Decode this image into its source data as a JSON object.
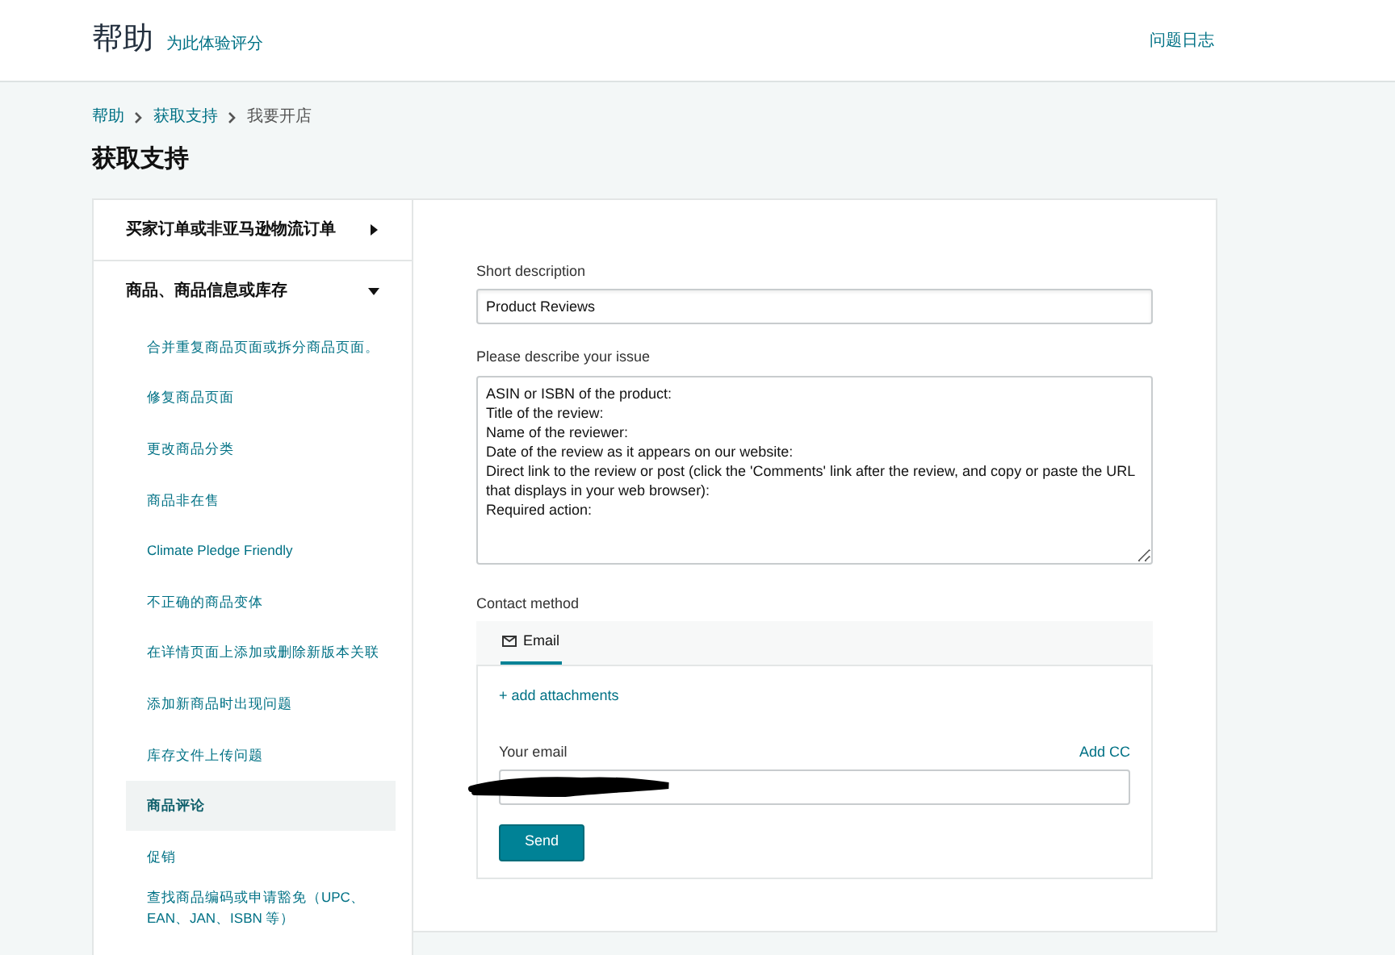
{
  "header": {
    "title": "帮助",
    "rate_link": "为此体验评分",
    "log_link": "问题日志"
  },
  "breadcrumb": [
    {
      "label": "帮助",
      "link": true
    },
    {
      "label": "获取支持",
      "link": true
    },
    {
      "label": "我要开店",
      "link": false
    }
  ],
  "page_title": "获取支持",
  "sidebar": {
    "categories": [
      {
        "label": "买家订单或非亚马逊物流订单",
        "expanded": false
      },
      {
        "label": "商品、商品信息或库存",
        "expanded": true,
        "children": [
          {
            "label": "合并重复商品页面或拆分商品页面。",
            "selected": false
          },
          {
            "label": "修复商品页面",
            "selected": false
          },
          {
            "label": "更改商品分类",
            "selected": false
          },
          {
            "label": "商品非在售",
            "selected": false
          },
          {
            "label": "Climate Pledge Friendly",
            "selected": false
          },
          {
            "label": "不正确的商品变体",
            "selected": false
          },
          {
            "label": "在详情页面上添加或删除新版本关联",
            "selected": false
          },
          {
            "label": "添加新商品时出现问题",
            "selected": false
          },
          {
            "label": "库存文件上传问题",
            "selected": false
          },
          {
            "label": "商品评论",
            "selected": true
          },
          {
            "label": "促销",
            "selected": false
          },
          {
            "label": "查找商品编码或申请豁免（UPC、EAN、JAN、ISBN 等）",
            "selected": false
          }
        ]
      }
    ]
  },
  "form": {
    "short_description": {
      "label": "Short description",
      "value": "Product Reviews"
    },
    "issue": {
      "label": "Please describe your issue",
      "value": "ASIN or ISBN of the product:\nTitle of the review:\nName of the reviewer:\nDate of the review as it appears on our website:\nDirect link to the review or post (click the 'Comments' link after the review, and copy or paste the URL that displays in your web browser):\nRequired action:"
    },
    "contact_label": "Contact method",
    "contact_tabs": [
      {
        "label": "Email",
        "selected": true
      }
    ],
    "add_attachments": "+ add attachments",
    "email_label": "Your email",
    "add_cc": "Add CC",
    "email_redacted": true,
    "send": "Send"
  }
}
